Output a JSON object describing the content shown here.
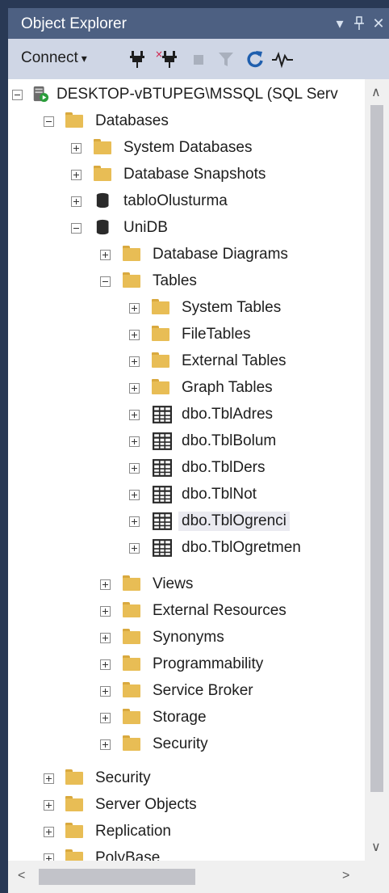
{
  "window": {
    "title": "Object Explorer",
    "dropdown_glyph": "▾",
    "pin_glyph": "ᛘ",
    "close_glyph": "✕"
  },
  "toolbar": {
    "connect_label": "Connect",
    "connect_arrow": "▾"
  },
  "tree": {
    "server": "DESKTOP-vBTUPEG\\MSSQL (SQL Serv",
    "databases": "Databases",
    "system_databases": "System Databases",
    "database_snapshots": "Database Snapshots",
    "db_tablo": "tabloOlusturma",
    "db_unidb": "UniDB",
    "database_diagrams": "Database Diagrams",
    "tables": "Tables",
    "system_tables": "System Tables",
    "file_tables": "FileTables",
    "external_tables": "External Tables",
    "graph_tables": "Graph Tables",
    "tbl_adres": "dbo.TblAdres",
    "tbl_bolum": "dbo.TblBolum",
    "tbl_ders": "dbo.TblDers",
    "tbl_not": "dbo.TblNot",
    "tbl_ogrenci": "dbo.TblOgrenci",
    "tbl_ogretmen": "dbo.TblOgretmen",
    "views": "Views",
    "external_resources": "External Resources",
    "synonyms": "Synonyms",
    "programmability": "Programmability",
    "service_broker": "Service Broker",
    "storage": "Storage",
    "db_security": "Security",
    "security": "Security",
    "server_objects": "Server Objects",
    "replication": "Replication",
    "polybase": "PolyBase"
  },
  "scroll": {
    "up": "∧",
    "down": "∨",
    "left": "<",
    "right": ">"
  }
}
